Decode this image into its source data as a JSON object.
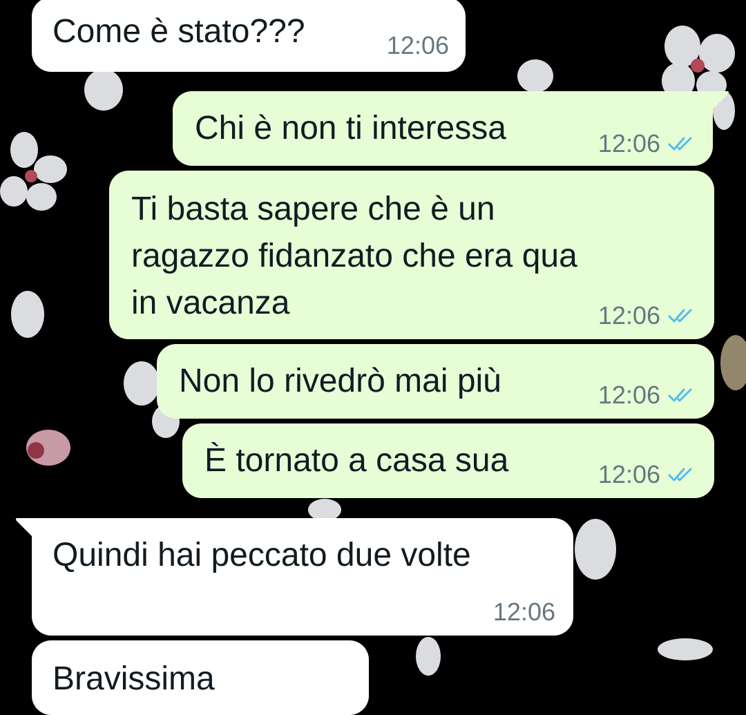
{
  "messages": [
    {
      "direction": "incoming",
      "text": "Come è stato???",
      "time": "12:06"
    },
    {
      "direction": "outgoing",
      "text": "Chi è non ti interessa",
      "time": "12:06",
      "status": "read",
      "status_icon": "double-check-icon"
    },
    {
      "direction": "outgoing",
      "text": "Ti basta sapere che è un\nragazzo fidanzato che era qua\nin vacanza",
      "time": "12:06",
      "status": "read",
      "status_icon": "double-check-icon"
    },
    {
      "direction": "outgoing",
      "text": "Non lo rivedrò mai più",
      "time": "12:06",
      "status": "read",
      "status_icon": "double-check-icon"
    },
    {
      "direction": "outgoing",
      "text": "È tornato a casa sua",
      "time": "12:06",
      "status": "read",
      "status_icon": "double-check-icon"
    },
    {
      "direction": "incoming",
      "text": "Quindi hai peccato due volte",
      "time": "12:06"
    },
    {
      "direction": "incoming",
      "text": "Bravissima",
      "time": ""
    }
  ],
  "colors": {
    "background": "#000000",
    "incoming_bubble": "#ffffff",
    "outgoing_bubble": "#e7fdd6",
    "message_text": "#111b21",
    "timestamp": "#667781",
    "read_ticks": "#53bdeb",
    "petals": "#eef0f5",
    "petal_centers": "#c24f62"
  }
}
